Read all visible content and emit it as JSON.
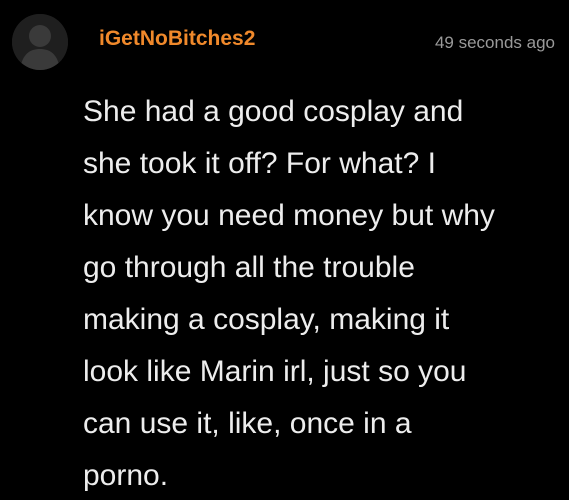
{
  "comment": {
    "avatar_icon": "default-user-silhouette-icon",
    "username": "iGetNoBitches2",
    "username_color": "#f0892b",
    "timestamp": "49 seconds ago",
    "body_lines": [
      "She had a good cosplay and",
      "she took it off? For what? I",
      "know you need money but why",
      "go through all the trouble",
      "making a cosplay, making it",
      "look like Marin irl, just so you",
      "can use it, like, once in a",
      "porno."
    ]
  }
}
